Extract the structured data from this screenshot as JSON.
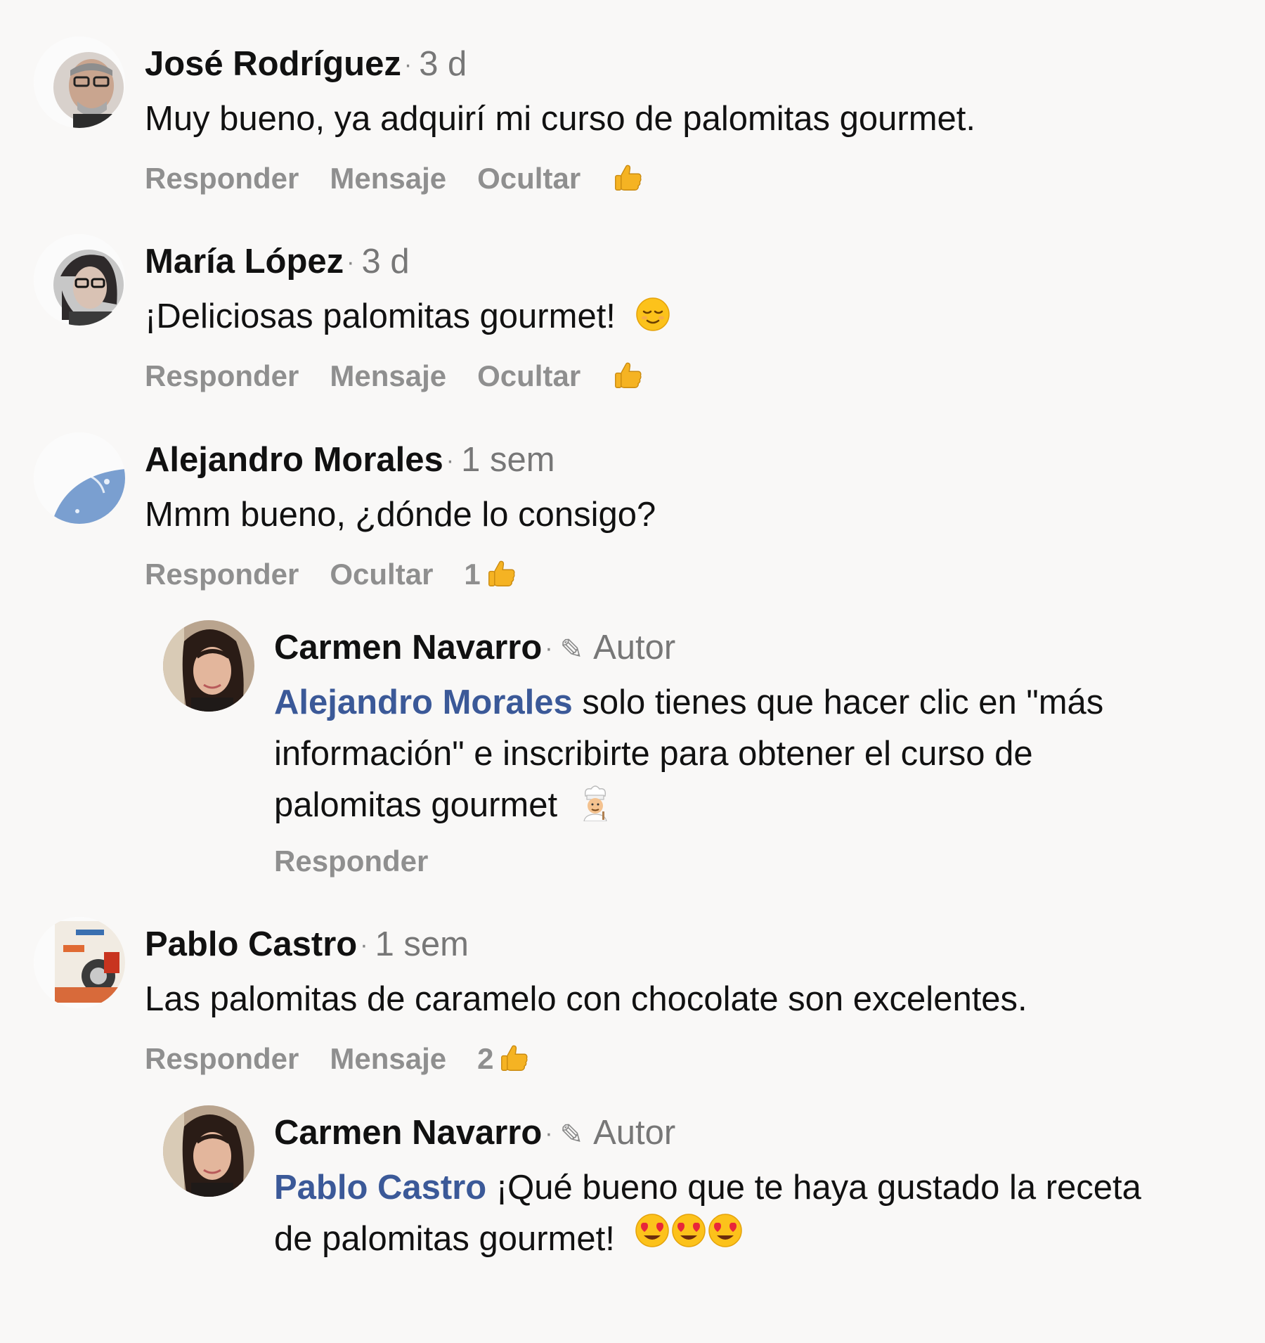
{
  "comments": [
    {
      "author": "José Rodríguez",
      "time": "3 d",
      "text": "Muy bueno, ya adquirí mi curso de palomitas gourmet.",
      "actions": [
        "Responder",
        "Mensaje",
        "Ocultar"
      ],
      "like_icon": "thumbs-up-icon"
    },
    {
      "author": "María López",
      "time": "3 d",
      "text": "¡Deliciosas palomitas gourmet!",
      "emoji": "relieved-face-icon",
      "actions": [
        "Responder",
        "Mensaje",
        "Ocultar"
      ],
      "like_icon": "thumbs-up-icon"
    },
    {
      "author": "Alejandro Morales",
      "time": "1 sem",
      "text": "Mmm bueno, ¿dónde lo consigo?",
      "actions": [
        "Responder",
        "Ocultar"
      ],
      "like_count": "1",
      "like_icon": "thumbs-up-icon",
      "reply": {
        "author": "Carmen Navarro",
        "tag": "Autor",
        "mention": "Alejandro Morales",
        "line1": "solo tienes que hacer clic en \"más",
        "line2": "información\" e inscribirte para obtener el curso de",
        "line3": "palomitas gourmet",
        "emoji": "chef-icon",
        "actions": [
          "Responder"
        ]
      }
    },
    {
      "author": "Pablo Castro",
      "time": "1 sem",
      "text": "Las palomitas de caramelo con chocolate son excelentes.",
      "actions": [
        "Responder",
        "Mensaje"
      ],
      "like_count": "2",
      "like_icon": "thumbs-up-icon",
      "reply": {
        "author": "Carmen Navarro",
        "tag": "Autor",
        "mention": "Pablo Castro",
        "line1": "¡Qué bueno que te haya gustado la receta",
        "line2": "de palomitas gourmet!",
        "emoji": "heart-eyes-icon"
      }
    }
  ],
  "colors": {
    "background": "#f9f8f7",
    "mention": "#3b5998",
    "action": "#8f8f8f",
    "meta": "#777777"
  }
}
